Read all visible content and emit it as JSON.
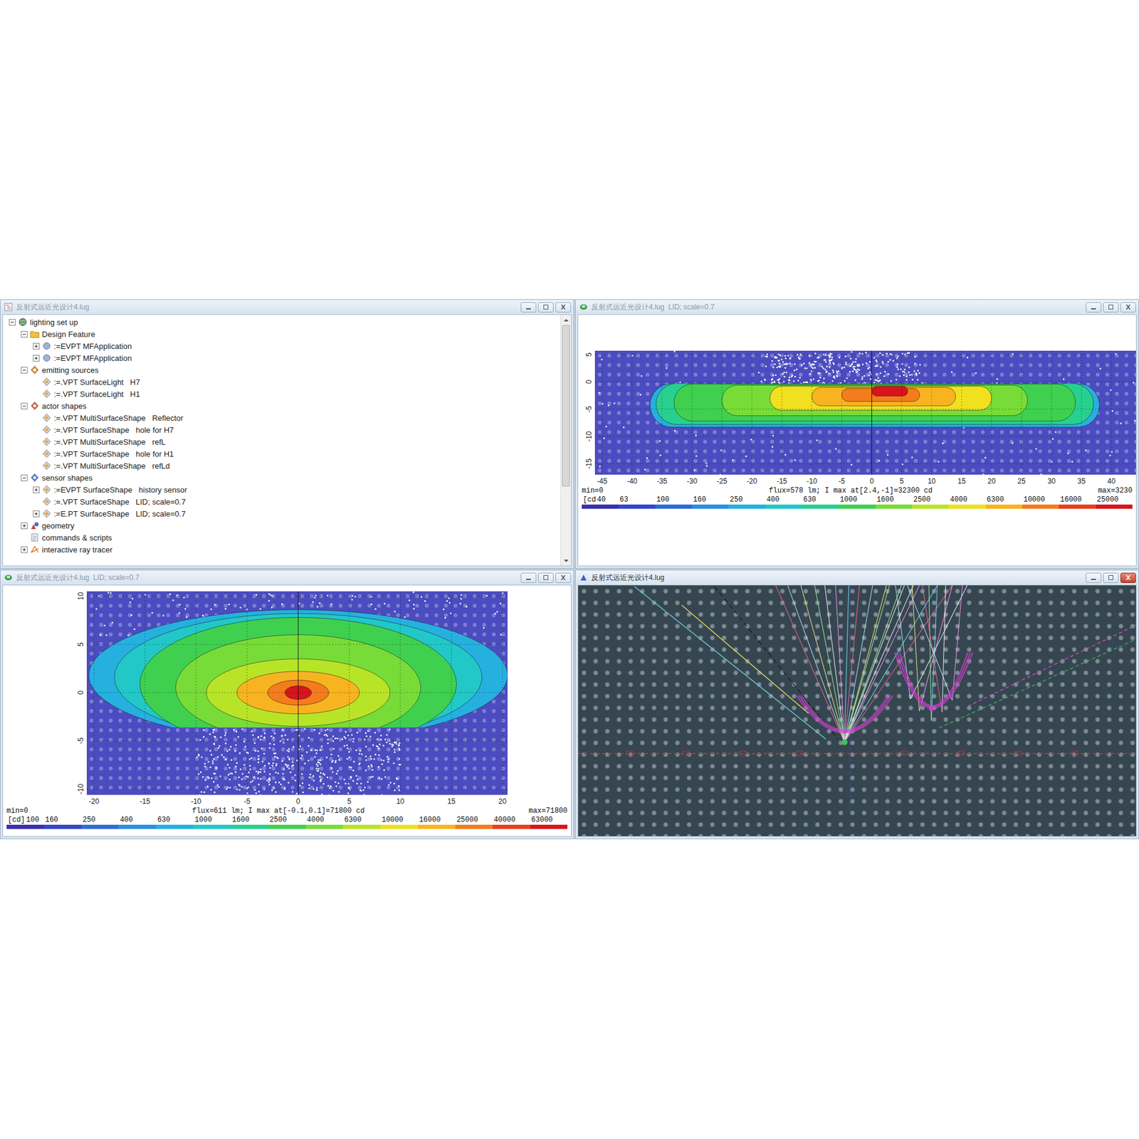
{
  "windows": {
    "tree": {
      "title": "反射式远近光设计4.lug",
      "active": false,
      "scroll_thumb": 0.7,
      "items": [
        {
          "label": "lighting set up",
          "depth": 0,
          "kind": "root",
          "expander": true,
          "expanded": true,
          "color": "#5f9a6a"
        },
        {
          "label": "Design Feature",
          "depth": 1,
          "kind": "folder",
          "expander": true,
          "expanded": true,
          "color": "#f0c040"
        },
        {
          "label": ":=EVPT MFApplication",
          "depth": 2,
          "kind": "app",
          "expander": true,
          "expanded": false,
          "color": "#9fb2d8"
        },
        {
          "label": ":=EVPT MFApplication",
          "depth": 2,
          "kind": "app",
          "expander": true,
          "expanded": false,
          "color": "#9fb2d8"
        },
        {
          "label": "emitting sources",
          "depth": 1,
          "kind": "group",
          "expander": true,
          "expanded": true,
          "color": "#e8902a"
        },
        {
          "label": ":=.VPT SurfaceLight   H7",
          "depth": 2,
          "kind": "item",
          "expander": false,
          "expanded": false,
          "color": "#e8a040"
        },
        {
          "label": ":=.VPT SurfaceLight   H1",
          "depth": 2,
          "kind": "item",
          "expander": false,
          "expanded": false,
          "color": "#e8a040"
        },
        {
          "label": "actor shapes",
          "depth": 1,
          "kind": "group",
          "expander": true,
          "expanded": true,
          "color": "#e0603a"
        },
        {
          "label": ":=.VPT MultiSurfaceShape   Reflector",
          "depth": 2,
          "kind": "item",
          "expander": false,
          "expanded": false,
          "color": "#e8a040"
        },
        {
          "label": ":=.VPT SurfaceShape   hole for H7",
          "depth": 2,
          "kind": "item",
          "expander": false,
          "expanded": false,
          "color": "#e8a040"
        },
        {
          "label": ":=.VPT MultiSurfaceShape   refL",
          "depth": 2,
          "kind": "item",
          "expander": false,
          "expanded": false,
          "color": "#e8a040"
        },
        {
          "label": ":=.VPT SurfaceShape   hole for H1",
          "depth": 2,
          "kind": "item",
          "expander": false,
          "expanded": false,
          "color": "#e8a040"
        },
        {
          "label": ":=.VPT MultiSurfaceShape   refLd",
          "depth": 2,
          "kind": "item",
          "expander": false,
          "expanded": false,
          "color": "#e8a040"
        },
        {
          "label": "sensor shapes",
          "depth": 1,
          "kind": "group",
          "expander": true,
          "expanded": true,
          "color": "#4a7ed0"
        },
        {
          "label": ":=EVPT SurfaceShape   history sensor",
          "depth": 2,
          "kind": "item",
          "expander": true,
          "expanded": false,
          "color": "#e8a040"
        },
        {
          "label": ":=.VPT SurfaceShape   LID; scale=0.7",
          "depth": 2,
          "kind": "item",
          "expander": false,
          "expanded": false,
          "color": "#e8a040"
        },
        {
          "label": ":=E.PT SurfaceShape   LID; scale=0.7",
          "depth": 2,
          "kind": "item",
          "expander": true,
          "expanded": false,
          "color": "#e8a040"
        },
        {
          "label": "geometry",
          "depth": 1,
          "kind": "geometry",
          "expander": true,
          "expanded": false,
          "color": "#d04040"
        },
        {
          "label": "commands & scripts",
          "depth": 1,
          "kind": "script",
          "expander": false,
          "expanded": false,
          "color": "#8090a0"
        },
        {
          "label": "interactive ray tracer",
          "depth": 1,
          "kind": "tracer",
          "expander": true,
          "expanded": false,
          "color": "#e07030"
        }
      ]
    },
    "chart_top": {
      "title": "反射式远近光设计4.lug  LID; scale=0.7",
      "active": false,
      "chart": {
        "shape": "capsule",
        "x_range": [
          -46.2,
          44.3
        ],
        "y_range": [
          -17,
          5.7
        ],
        "x_ticks": [
          "-45",
          "-40",
          "-35",
          "-30",
          "-25",
          "-20",
          "-15",
          "-10",
          "-5",
          "0",
          "5",
          "10",
          "15",
          "20",
          "25",
          "30",
          "35",
          "40"
        ],
        "y_ticks": [
          "5",
          "0",
          "-5",
          "-10",
          "-15"
        ],
        "clip": {
          "ymin": -17,
          "ymax": -0.3
        },
        "scatter": [
          {
            "x": [
              -18,
              8
            ],
            "y": [
              -0.3,
              5.5
            ],
            "count": 260
          },
          {
            "x": [
              -46,
              44
            ],
            "y": [
              -17,
              5.7
            ],
            "count": 120
          }
        ],
        "bands": [
          {
            "x": [
              -37,
              38
            ],
            "y": [
              -8.3,
              -0.3
            ],
            "color": "#26b0e0"
          },
          {
            "x": [
              -36,
              37
            ],
            "y": [
              -7.8,
              -0.3
            ],
            "color": "#28d090"
          },
          {
            "x": [
              -33,
              34
            ],
            "y": [
              -7.2,
              -0.4
            ],
            "color": "#40d050"
          },
          {
            "x": [
              -25,
              26
            ],
            "y": [
              -6.2,
              -0.6
            ],
            "color": "#78dc38"
          },
          {
            "x": [
              -17,
              20
            ],
            "y": [
              -5.2,
              -0.8
            ],
            "color": "#f0e020"
          },
          {
            "x": [
              -10,
              14
            ],
            "y": [
              -4.4,
              -1.0
            ],
            "color": "#f8b420"
          },
          {
            "x": [
              -5,
              8
            ],
            "y": [
              -3.6,
              -1.2
            ],
            "color": "#f47c1c"
          },
          {
            "x": [
              0,
              6
            ],
            "y": [
              -2.6,
              -0.8
            ],
            "color": "#d8141c"
          }
        ],
        "footer": {
          "min": "min=0",
          "flux": "flux=578 lm; I max at[2.4,-1]=32300 cd",
          "max": "max=3230"
        },
        "legend": {
          "unit": "[cd",
          "items": [
            {
              "label": "40",
              "color": "#3b2fb0"
            },
            {
              "label": "63",
              "color": "#3346c8"
            },
            {
              "label": "100",
              "color": "#2f6ad8"
            },
            {
              "label": "160",
              "color": "#2a8ee0"
            },
            {
              "label": "250",
              "color": "#26b0e0"
            },
            {
              "label": "400",
              "color": "#22c8c8"
            },
            {
              "label": "630",
              "color": "#28d090"
            },
            {
              "label": "1000",
              "color": "#40d050"
            },
            {
              "label": "1600",
              "color": "#78dc38"
            },
            {
              "label": "2500",
              "color": "#b8e428"
            },
            {
              "label": "4000",
              "color": "#f0e020"
            },
            {
              "label": "6300",
              "color": "#f8b420"
            },
            {
              "label": "10000",
              "color": "#f47c1c"
            },
            {
              "label": "16000",
              "color": "#e8401c"
            },
            {
              "label": "25000",
              "color": "#d8141c"
            }
          ]
        }
      }
    },
    "chart_bottom": {
      "title": "反射式远近光设计4.lug  LID; scale=0.7",
      "active": false,
      "chart": {
        "shape": "ellipse",
        "x_range": [
          -20.7,
          20.5
        ],
        "y_range": [
          -10.6,
          10.5
        ],
        "x_ticks": [
          "-20",
          "-15",
          "-10",
          "-5",
          "0",
          "5",
          "10",
          "15",
          "20"
        ],
        "y_ticks": [
          "10",
          "5",
          "0",
          "-5",
          "-10"
        ],
        "clip": {
          "ymin": -3.6,
          "ymax": 10.5
        },
        "scatter": [
          {
            "x": [
              -10,
              10
            ],
            "y": [
              -10.6,
              -3.7
            ],
            "count": 420
          },
          {
            "x": [
              -20,
              20
            ],
            "y": [
              6,
              10.5
            ],
            "count": 110
          }
        ],
        "bands": [
          {
            "x": [
              -20.5,
              20.5
            ],
            "y": [
              -5,
              8.6
            ],
            "color": "#26b0e0"
          },
          {
            "x": [
              -18,
              18
            ],
            "y": [
              -5,
              8.2
            ],
            "color": "#22c8c8"
          },
          {
            "x": [
              -15.5,
              15.5
            ],
            "y": [
              -6,
              7.8
            ],
            "color": "#40d050"
          },
          {
            "x": [
              -12,
              12
            ],
            "y": [
              -5,
              6
            ],
            "color": "#78dc38"
          },
          {
            "x": [
              -9,
              9
            ],
            "y": [
              -3.5,
              3.5
            ],
            "color": "#b8e428"
          },
          {
            "x": [
              -6,
              6
            ],
            "y": [
              -2.2,
              2.2
            ],
            "color": "#f8b420"
          },
          {
            "x": [
              -3,
              3
            ],
            "y": [
              -1.3,
              1.3
            ],
            "color": "#f47c1c"
          },
          {
            "x": [
              -1.3,
              1.3
            ],
            "y": [
              -0.7,
              0.7
            ],
            "color": "#d8141c"
          }
        ],
        "footer": {
          "min": "min=0",
          "flux": "flux=611 lm; I max at[-0.1,0.1]=71800 cd",
          "max": "max=71800"
        },
        "legend": {
          "unit": "[cd]",
          "items": [
            {
              "label": "100",
              "color": "#3b2fb0"
            },
            {
              "label": "160",
              "color": "#3346c8"
            },
            {
              "label": "250",
              "color": "#2f6ad8"
            },
            {
              "label": "400",
              "color": "#2a8ee0"
            },
            {
              "label": "630",
              "color": "#26b0e0"
            },
            {
              "label": "1000",
              "color": "#22c8c8"
            },
            {
              "label": "1600",
              "color": "#28d090"
            },
            {
              "label": "2500",
              "color": "#40d050"
            },
            {
              "label": "4000",
              "color": "#78dc38"
            },
            {
              "label": "6300",
              "color": "#b8e428"
            },
            {
              "label": "10000",
              "color": "#f0e020"
            },
            {
              "label": "16000",
              "color": "#f8b420"
            },
            {
              "label": "25000",
              "color": "#f47c1c"
            },
            {
              "label": "40000",
              "color": "#e8401c"
            },
            {
              "label": "63000",
              "color": "#d8141c"
            }
          ]
        }
      }
    },
    "tracer": {
      "title": "反射式远近光设计4.lug",
      "active": true
    }
  }
}
